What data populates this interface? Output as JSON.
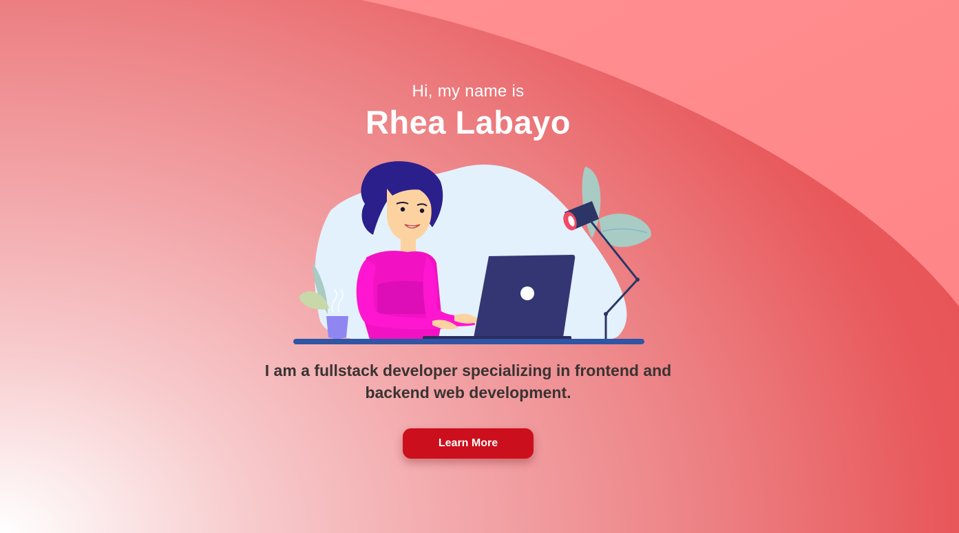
{
  "hero": {
    "greeting": "Hi, my name is",
    "name": "Rhea Labayo",
    "tagline": "I am a fullstack developer specializing in frontend and backend web development.",
    "cta_label": "Learn More"
  },
  "colors": {
    "background_light": "#ffffff",
    "background_coral": "#e54b4e",
    "wave": "#ff8a8c",
    "button": "#cc0f1c",
    "tagline_text": "#3a3333"
  },
  "illustration": {
    "icon": "developer-at-laptop-illustration"
  }
}
